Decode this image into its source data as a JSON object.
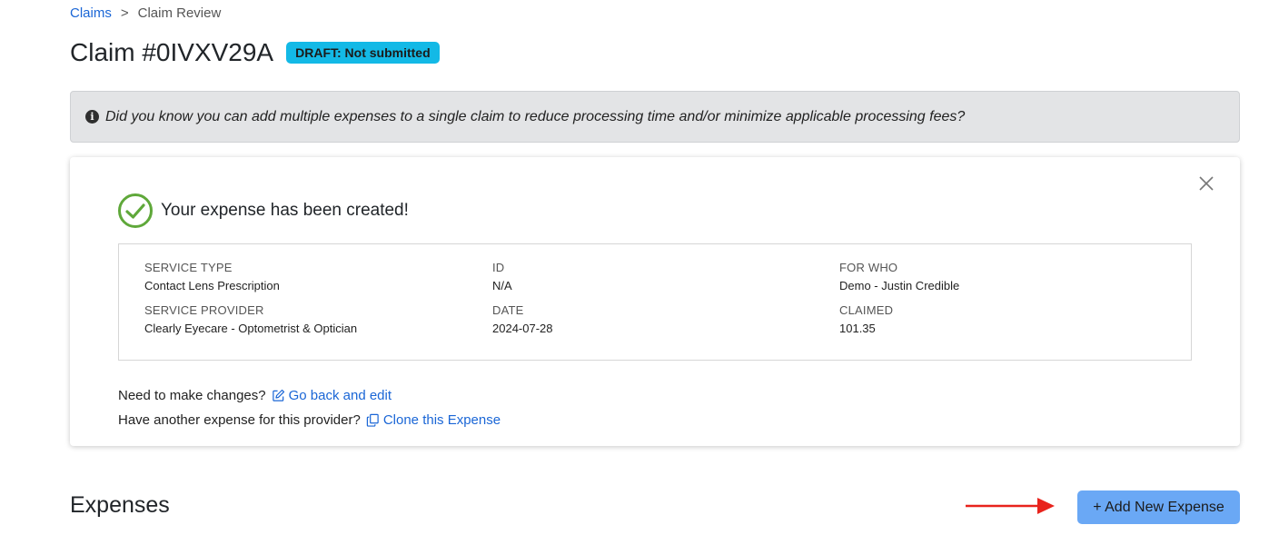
{
  "breadcrumb": {
    "parent": "Claims",
    "separator": ">",
    "current": "Claim Review"
  },
  "claim": {
    "title": "Claim #0IVXV29A",
    "status": "DRAFT: Not submitted",
    "status_color": "#13b9e6"
  },
  "tip": {
    "icon": "info-icon",
    "text": "Did you know you can add multiple expenses to a single claim to reduce processing time and/or minimize applicable processing fees?"
  },
  "success": {
    "icon": "check-circle-icon",
    "title": "Your expense has been created!",
    "details": {
      "service_type": {
        "label": "SERVICE TYPE",
        "value": "Contact Lens Prescription"
      },
      "id": {
        "label": "ID",
        "value": "N/A"
      },
      "for_who": {
        "label": "FOR WHO",
        "value": "Demo - Justin Credible"
      },
      "service_provider": {
        "label": "SERVICE PROVIDER",
        "value": "Clearly Eyecare - Optometrist & Optician"
      },
      "date": {
        "label": "DATE",
        "value": "2024-07-28"
      },
      "claimed": {
        "label": "CLAIMED",
        "value": "101.35"
      }
    },
    "changes_prompt": "Need to make changes?",
    "edit_link": "Go back and edit",
    "clone_prompt": "Have another expense for this provider?",
    "clone_link": "Clone this Expense"
  },
  "expenses": {
    "title": "Expenses",
    "add_button": "+ Add New Expense"
  },
  "colors": {
    "link": "#1a66d6",
    "success_check": "#5fa83a",
    "button": "#6aa8f5",
    "arrow": "#e8231c"
  }
}
